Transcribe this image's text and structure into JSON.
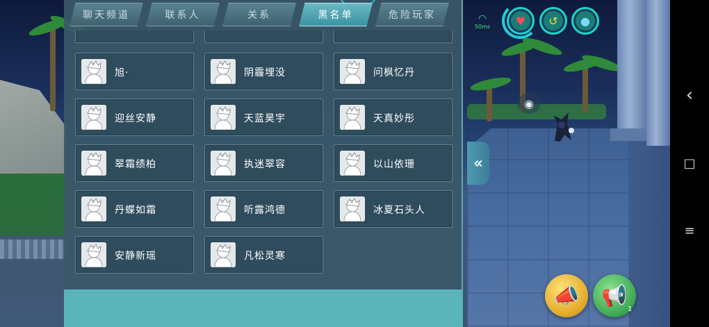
{
  "tabs": [
    {
      "label": "聊天频道",
      "active": false
    },
    {
      "label": "联系人",
      "active": false
    },
    {
      "label": "关系",
      "active": false
    },
    {
      "label": "黑名单",
      "active": true
    },
    {
      "label": "危险玩家",
      "active": false
    }
  ],
  "blacklist": [
    {
      "name": "旭·"
    },
    {
      "name": "阴霾埋没"
    },
    {
      "name": "问枫忆丹"
    },
    {
      "name": "迎丝安静"
    },
    {
      "name": "天蓝昊宇"
    },
    {
      "name": "天真妙彤"
    },
    {
      "name": "翠霜绩柏"
    },
    {
      "name": "执迷翠容"
    },
    {
      "name": "以山依珊"
    },
    {
      "name": "丹蝶如霜"
    },
    {
      "name": "听露鸿德"
    },
    {
      "name": "冰夏石头人"
    },
    {
      "name": "安静新瑶"
    },
    {
      "name": "凡松灵寒"
    }
  ],
  "hud": {
    "ping": "50ms",
    "status_icons": [
      "heart-icon",
      "stamina-arm-icon",
      "water-drop-icon"
    ],
    "accent_color": "#1bd6c9"
  },
  "actions": {
    "collapse_glyph": "«",
    "horn_badge": "1"
  },
  "navbar": {
    "back_glyph": "‹",
    "home_glyph": "□",
    "menu_glyph": "≡"
  }
}
